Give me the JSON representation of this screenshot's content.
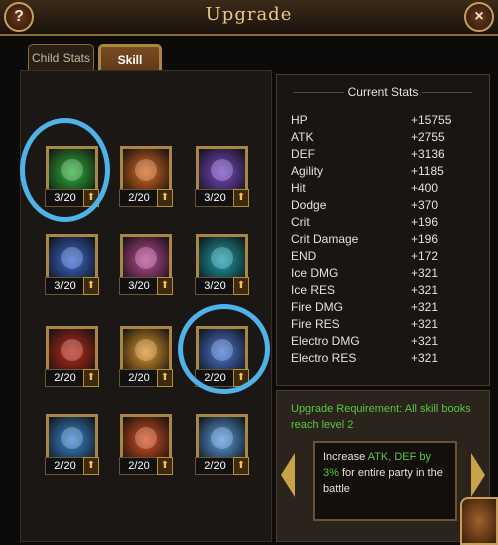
{
  "window": {
    "title": "Upgrade",
    "help_label": "?",
    "close_label": "×"
  },
  "tabs": [
    {
      "label": "Child Stats"
    },
    {
      "label": "Skill"
    }
  ],
  "skills": [
    {
      "count": "3/20",
      "icon": "green-orb-icon",
      "color": "#2fb63a"
    },
    {
      "count": "2/20",
      "icon": "fire-sword-icon",
      "color": "#e06a1e"
    },
    {
      "count": "3/20",
      "icon": "purple-shield-icon",
      "color": "#7a4ad0"
    },
    {
      "count": "3/20",
      "icon": "blue-gauntlet-icon",
      "color": "#3a6ad8"
    },
    {
      "count": "3/20",
      "icon": "pink-skull-icon",
      "color": "#c24a9a"
    },
    {
      "count": "3/20",
      "icon": "teal-figure-icon",
      "color": "#1aa3b0"
    },
    {
      "count": "2/20",
      "icon": "red-spear-icon",
      "color": "#c22a1a"
    },
    {
      "count": "2/20",
      "icon": "golden-blade-icon",
      "color": "#e39a2a"
    },
    {
      "count": "2/20",
      "icon": "blue-vortex-icon",
      "color": "#4a7ae0"
    },
    {
      "count": "2/20",
      "icon": "ice-crystal-icon",
      "color": "#3a8ad8"
    },
    {
      "count": "2/20",
      "icon": "flame-icon",
      "color": "#e0501e"
    },
    {
      "count": "2/20",
      "icon": "lightning-icon",
      "color": "#5aa0e8"
    }
  ],
  "stats": {
    "title": "Current Stats",
    "rows": [
      {
        "name": "HP",
        "value": "+15755"
      },
      {
        "name": "ATK",
        "value": "+2755"
      },
      {
        "name": "DEF",
        "value": "+3136"
      },
      {
        "name": "Agility",
        "value": "+1185"
      },
      {
        "name": "Hit",
        "value": "+400"
      },
      {
        "name": "Dodge",
        "value": "+370"
      },
      {
        "name": "Crit",
        "value": "+196"
      },
      {
        "name": "Crit Damage",
        "value": "+196"
      },
      {
        "name": "END",
        "value": "+172"
      },
      {
        "name": "Ice DMG",
        "value": "+321"
      },
      {
        "name": "Ice RES",
        "value": "+321"
      },
      {
        "name": "Fire DMG",
        "value": "+321"
      },
      {
        "name": "Fire RES",
        "value": "+321"
      },
      {
        "name": "Electro DMG",
        "value": "+321"
      },
      {
        "name": "Electro RES",
        "value": "+321"
      }
    ]
  },
  "requirement": {
    "text": "Upgrade Requirement: All skill books reach level 2"
  },
  "description": {
    "prefix": "Increase ",
    "highlight_stats": "ATK, DEF by",
    "highlight_pct": "3%",
    "suffix": " for entire party in the battle"
  }
}
